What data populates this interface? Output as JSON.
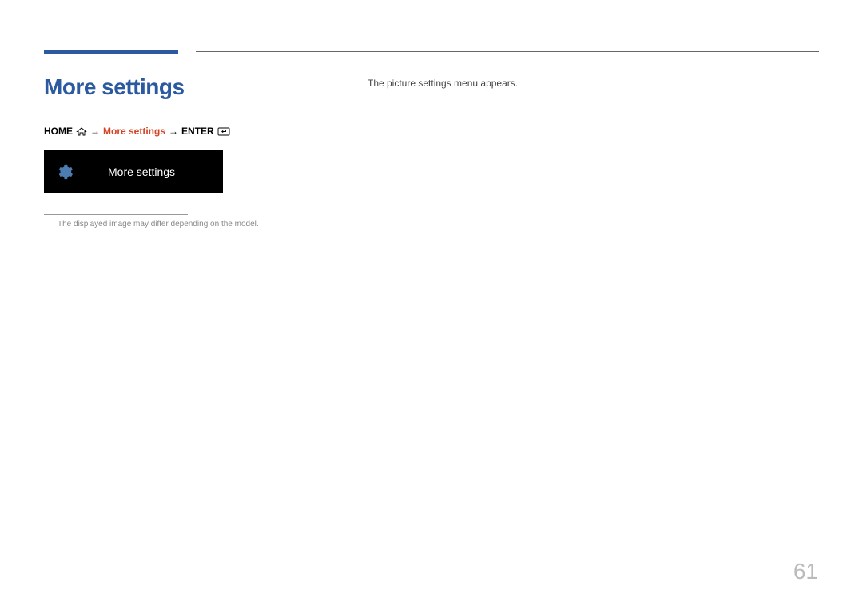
{
  "section": {
    "title": "More settings"
  },
  "breadcrumb": {
    "home": "HOME",
    "highlight": "More settings",
    "enter": "ENTER",
    "arrow": "→"
  },
  "menu_box": {
    "label": "More settings"
  },
  "note": {
    "dash": "―",
    "text": "The displayed image may differ depending on the model."
  },
  "description": {
    "text": "The picture settings menu appears."
  },
  "page_number": "61"
}
